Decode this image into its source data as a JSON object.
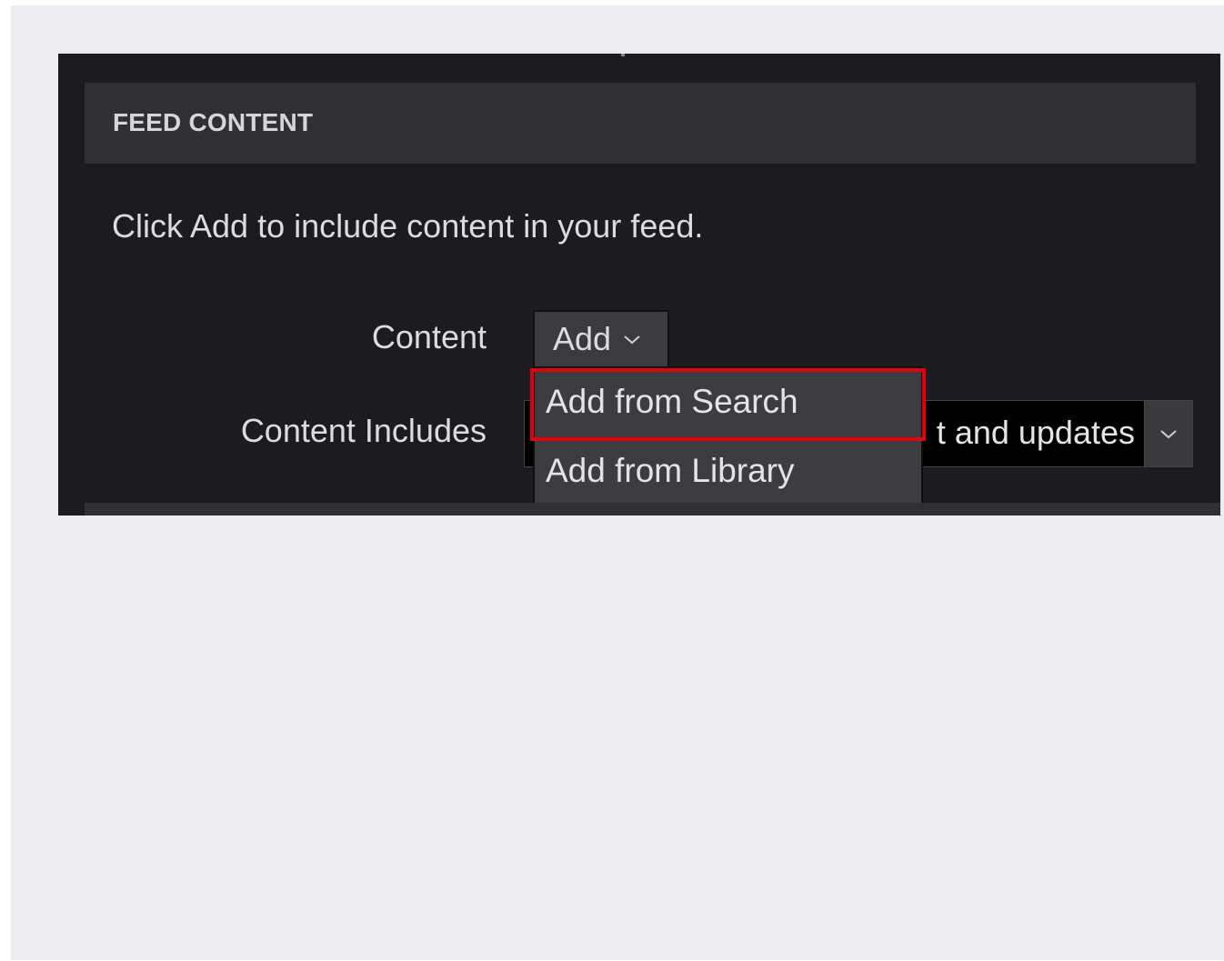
{
  "section": {
    "title": "FEED CONTENT",
    "instructions": "Click Add to include content in your feed."
  },
  "form": {
    "content_label": "Content",
    "add_button_label": "Add",
    "content_includes_label": "Content Includes",
    "content_includes_value": "t and updates"
  },
  "dropdown": {
    "items": [
      {
        "label": "Add from Search",
        "highlighted": true
      },
      {
        "label": "Add from Library",
        "highlighted": false
      }
    ]
  },
  "colors": {
    "panel_background": "#1c1c1f",
    "header_background": "#303034",
    "highlight_border": "#e00010",
    "page_background": "#ececee"
  },
  "icons": {
    "add_dropdown": "chevron-down-icon",
    "includes_dropdown": "chevron-down-icon"
  }
}
